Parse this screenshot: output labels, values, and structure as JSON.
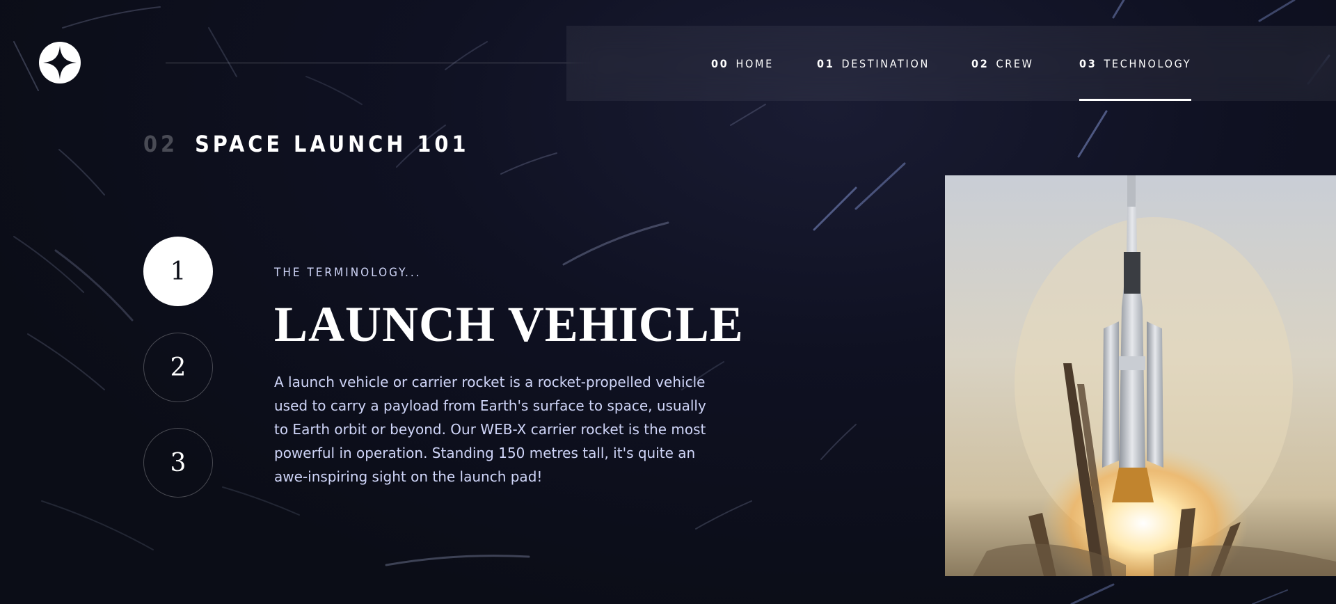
{
  "nav": {
    "items": [
      {
        "num": "00",
        "label": "HOME"
      },
      {
        "num": "01",
        "label": "DESTINATION"
      },
      {
        "num": "02",
        "label": "CREW"
      },
      {
        "num": "03",
        "label": "TECHNOLOGY"
      }
    ],
    "active_index": 3
  },
  "page": {
    "heading_num": "02",
    "heading_label": "SPACE LAUNCH 101"
  },
  "steps": [
    "1",
    "2",
    "3"
  ],
  "active_step": 0,
  "content": {
    "eyebrow": "THE TERMINOLOGY...",
    "title": "LAUNCH VEHICLE",
    "description": "A launch vehicle or carrier rocket is a rocket-propelled vehicle used to carry a payload from Earth's surface to space, usually to Earth orbit or beyond. Our WEB-X carrier rocket is the most powerful in operation. Standing 150 metres tall, it's quite an awe-inspiring sight on the launch pad!"
  },
  "icons": {
    "logo": "four-point-star-logo-icon"
  },
  "colors": {
    "background": "#0b0d17",
    "text_light": "#d0d6f9",
    "white": "#ffffff"
  }
}
